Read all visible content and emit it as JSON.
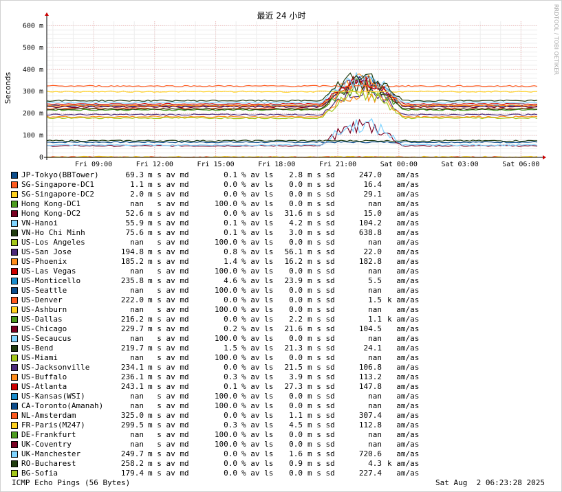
{
  "chart_data": {
    "type": "line",
    "title": "最近 24 小时",
    "ylabel": "Seconds",
    "side_label": "RRDTOOL / TOBI OETIKER",
    "ylim": [
      0,
      0.62
    ],
    "yticks": [
      "0",
      "100 m",
      "200 m",
      "300 m",
      "400 m",
      "500 m",
      "600 m"
    ],
    "xticks": [
      "Fri 09:00",
      "Fri 12:00",
      "Fri 15:00",
      "Fri 18:00",
      "Fri 21:00",
      "Sat 00:00",
      "Sat 03:00",
      "Sat 06:00"
    ],
    "x_range_hours": [
      6.7,
      30.8
    ],
    "grid": true,
    "series": [
      {
        "name": "JP-Tokyo(BBTower)",
        "color": "#0c4d8c",
        "median": 0.0693
      },
      {
        "name": "SG-Singapore-DC1",
        "color": "#ff5a1f",
        "median": 0.0011
      },
      {
        "name": "SG-Singapore-DC2",
        "color": "#ffd21f",
        "median": 0.002
      },
      {
        "name": "Hong Kong-DC1",
        "color": "#4c9c1f",
        "median": null
      },
      {
        "name": "Hong Kong-DC2",
        "color": "#7a0022",
        "median": 0.0526
      },
      {
        "name": "VN-Hanoi",
        "color": "#80d4ff",
        "median": 0.0559
      },
      {
        "name": "VN-Ho Chi Minh",
        "color": "#213d10",
        "median": 0.0756
      },
      {
        "name": "US-Los Angeles",
        "color": "#a4c81a",
        "median": null
      },
      {
        "name": "US-San Jose",
        "color": "#4c2a7a",
        "median": 0.1948
      },
      {
        "name": "US-Phoenix",
        "color": "#ff8c1a",
        "median": 0.1852
      },
      {
        "name": "US-Las Vegas",
        "color": "#cc0000",
        "median": null
      },
      {
        "name": "US-Monticello",
        "color": "#1a8ccc",
        "median": 0.2358
      },
      {
        "name": "US-Seattle",
        "color": "#0c4d8c",
        "median": null
      },
      {
        "name": "US-Denver",
        "color": "#ff5a1f",
        "median": 0.222
      },
      {
        "name": "US-Ashburn",
        "color": "#ffd21f",
        "median": null
      },
      {
        "name": "US-Dallas",
        "color": "#4c9c1f",
        "median": 0.2162
      },
      {
        "name": "US-Chicago",
        "color": "#7a0022",
        "median": 0.2297
      },
      {
        "name": "US-Secaucus",
        "color": "#80d4ff",
        "median": null
      },
      {
        "name": "US-Bend",
        "color": "#213d10",
        "median": 0.2197
      },
      {
        "name": "US-Miami",
        "color": "#a4c81a",
        "median": null
      },
      {
        "name": "US-Jacksonville",
        "color": "#4c2a7a",
        "median": 0.2341
      },
      {
        "name": "US-Buffalo",
        "color": "#ff8c1a",
        "median": 0.2361
      },
      {
        "name": "US-Atlanta",
        "color": "#cc0000",
        "median": 0.2431
      },
      {
        "name": "US-Kansas(WSI)",
        "color": "#1a8ccc",
        "median": null
      },
      {
        "name": "CA-Toronto(Amanah)",
        "color": "#0c4d8c",
        "median": null
      },
      {
        "name": "NL-Amsterdam",
        "color": "#ff5a1f",
        "median": 0.325
      },
      {
        "name": "FR-Paris(M247)",
        "color": "#ffd21f",
        "median": 0.2995
      },
      {
        "name": "DE-Frankfurt",
        "color": "#4c9c1f",
        "median": null
      },
      {
        "name": "UK-Coventry",
        "color": "#7a0022",
        "median": null
      },
      {
        "name": "UK-Manchester",
        "color": "#80d4ff",
        "median": 0.2497
      },
      {
        "name": "RO-Bucharest",
        "color": "#213d10",
        "median": 0.2582
      },
      {
        "name": "BG-Sofia",
        "color": "#a4c81a",
        "median": 0.1794
      }
    ]
  },
  "legend": {
    "unit_median": "s av md",
    "unit_loss": "% av ls",
    "unit_sd": "s sd",
    "unit_amas": "am/as",
    "rows": [
      {
        "name": "JP-Tokyo(BBTower)",
        "median": "69.3",
        "mp": "m",
        "loss": "0.1",
        "sd": "2.8",
        "sp": "m",
        "amas": "247.0",
        "ap": " "
      },
      {
        "name": "SG-Singapore-DC1",
        "median": "1.1",
        "mp": "m",
        "loss": "0.0",
        "sd": "0.0",
        "sp": "m",
        "amas": "16.4",
        "ap": " "
      },
      {
        "name": "SG-Singapore-DC2",
        "median": "2.0",
        "mp": "m",
        "loss": "0.0",
        "sd": "0.0",
        "sp": "m",
        "amas": "29.1",
        "ap": " "
      },
      {
        "name": "Hong Kong-DC1",
        "median": "nan",
        "mp": " ",
        "loss": "100.0",
        "sd": "0.0",
        "sp": "m",
        "amas": "nan",
        "ap": " "
      },
      {
        "name": "Hong Kong-DC2",
        "median": "52.6",
        "mp": "m",
        "loss": "0.0",
        "sd": "31.6",
        "sp": "m",
        "amas": "15.0",
        "ap": " "
      },
      {
        "name": "VN-Hanoi",
        "median": "55.9",
        "mp": "m",
        "loss": "0.1",
        "sd": "4.2",
        "sp": "m",
        "amas": "104.2",
        "ap": " "
      },
      {
        "name": "VN-Ho Chi Minh",
        "median": "75.6",
        "mp": "m",
        "loss": "0.1",
        "sd": "3.0",
        "sp": "m",
        "amas": "638.8",
        "ap": " "
      },
      {
        "name": "US-Los Angeles",
        "median": "nan",
        "mp": " ",
        "loss": "100.0",
        "sd": "0.0",
        "sp": "m",
        "amas": "nan",
        "ap": " "
      },
      {
        "name": "US-San Jose",
        "median": "194.8",
        "mp": "m",
        "loss": "0.8",
        "sd": "56.1",
        "sp": "m",
        "amas": "22.0",
        "ap": " "
      },
      {
        "name": "US-Phoenix",
        "median": "185.2",
        "mp": "m",
        "loss": "1.4",
        "sd": "16.2",
        "sp": "m",
        "amas": "182.8",
        "ap": " "
      },
      {
        "name": "US-Las Vegas",
        "median": "nan",
        "mp": " ",
        "loss": "100.0",
        "sd": "0.0",
        "sp": "m",
        "amas": "nan",
        "ap": " "
      },
      {
        "name": "US-Monticello",
        "median": "235.8",
        "mp": "m",
        "loss": "4.6",
        "sd": "23.9",
        "sp": "m",
        "amas": "5.5",
        "ap": " "
      },
      {
        "name": "US-Seattle",
        "median": "nan",
        "mp": " ",
        "loss": "100.0",
        "sd": "0.0",
        "sp": "m",
        "amas": "nan",
        "ap": " "
      },
      {
        "name": "US-Denver",
        "median": "222.0",
        "mp": "m",
        "loss": "0.0",
        "sd": "0.0",
        "sp": "m",
        "amas": "1.5",
        "ap": "k"
      },
      {
        "name": "US-Ashburn",
        "median": "nan",
        "mp": " ",
        "loss": "100.0",
        "sd": "0.0",
        "sp": "m",
        "amas": "nan",
        "ap": " "
      },
      {
        "name": "US-Dallas",
        "median": "216.2",
        "mp": "m",
        "loss": "0.0",
        "sd": "2.2",
        "sp": "m",
        "amas": "1.1",
        "ap": "k"
      },
      {
        "name": "US-Chicago",
        "median": "229.7",
        "mp": "m",
        "loss": "0.2",
        "sd": "21.6",
        "sp": "m",
        "amas": "104.5",
        "ap": " "
      },
      {
        "name": "US-Secaucus",
        "median": "nan",
        "mp": " ",
        "loss": "100.0",
        "sd": "0.0",
        "sp": "m",
        "amas": "nan",
        "ap": " "
      },
      {
        "name": "US-Bend",
        "median": "219.7",
        "mp": "m",
        "loss": "1.5",
        "sd": "21.3",
        "sp": "m",
        "amas": "24.1",
        "ap": " "
      },
      {
        "name": "US-Miami",
        "median": "nan",
        "mp": " ",
        "loss": "100.0",
        "sd": "0.0",
        "sp": "m",
        "amas": "nan",
        "ap": " "
      },
      {
        "name": "US-Jacksonville",
        "median": "234.1",
        "mp": "m",
        "loss": "0.0",
        "sd": "21.5",
        "sp": "m",
        "amas": "106.8",
        "ap": " "
      },
      {
        "name": "US-Buffalo",
        "median": "236.1",
        "mp": "m",
        "loss": "0.3",
        "sd": "3.9",
        "sp": "m",
        "amas": "113.2",
        "ap": " "
      },
      {
        "name": "US-Atlanta",
        "median": "243.1",
        "mp": "m",
        "loss": "0.1",
        "sd": "27.3",
        "sp": "m",
        "amas": "147.8",
        "ap": " "
      },
      {
        "name": "US-Kansas(WSI)",
        "median": "nan",
        "mp": " ",
        "loss": "100.0",
        "sd": "0.0",
        "sp": "m",
        "amas": "nan",
        "ap": " "
      },
      {
        "name": "CA-Toronto(Amanah)",
        "median": "nan",
        "mp": " ",
        "loss": "100.0",
        "sd": "0.0",
        "sp": "m",
        "amas": "nan",
        "ap": " "
      },
      {
        "name": "NL-Amsterdam",
        "median": "325.0",
        "mp": "m",
        "loss": "0.0",
        "sd": "1.1",
        "sp": "m",
        "amas": "307.4",
        "ap": " "
      },
      {
        "name": "FR-Paris(M247)",
        "median": "299.5",
        "mp": "m",
        "loss": "0.3",
        "sd": "4.5",
        "sp": "m",
        "amas": "112.8",
        "ap": " "
      },
      {
        "name": "DE-Frankfurt",
        "median": "nan",
        "mp": " ",
        "loss": "100.0",
        "sd": "0.0",
        "sp": "m",
        "amas": "nan",
        "ap": " "
      },
      {
        "name": "UK-Coventry",
        "median": "nan",
        "mp": " ",
        "loss": "100.0",
        "sd": "0.0",
        "sp": "m",
        "amas": "nan",
        "ap": " "
      },
      {
        "name": "UK-Manchester",
        "median": "249.7",
        "mp": "m",
        "loss": "0.0",
        "sd": "1.6",
        "sp": "m",
        "amas": "720.6",
        "ap": " "
      },
      {
        "name": "RO-Bucharest",
        "median": "258.2",
        "mp": "m",
        "loss": "0.0",
        "sd": "0.9",
        "sp": "m",
        "amas": "4.3",
        "ap": "k"
      },
      {
        "name": "BG-Sofia",
        "median": "179.4",
        "mp": "m",
        "loss": "0.0",
        "sd": "0.0",
        "sp": "m",
        "amas": "227.4",
        "ap": " "
      }
    ]
  },
  "footer": {
    "left": "ICMP Echo Pings (56 Bytes)",
    "right": "Sat Aug  2 06:23:28 2025"
  }
}
